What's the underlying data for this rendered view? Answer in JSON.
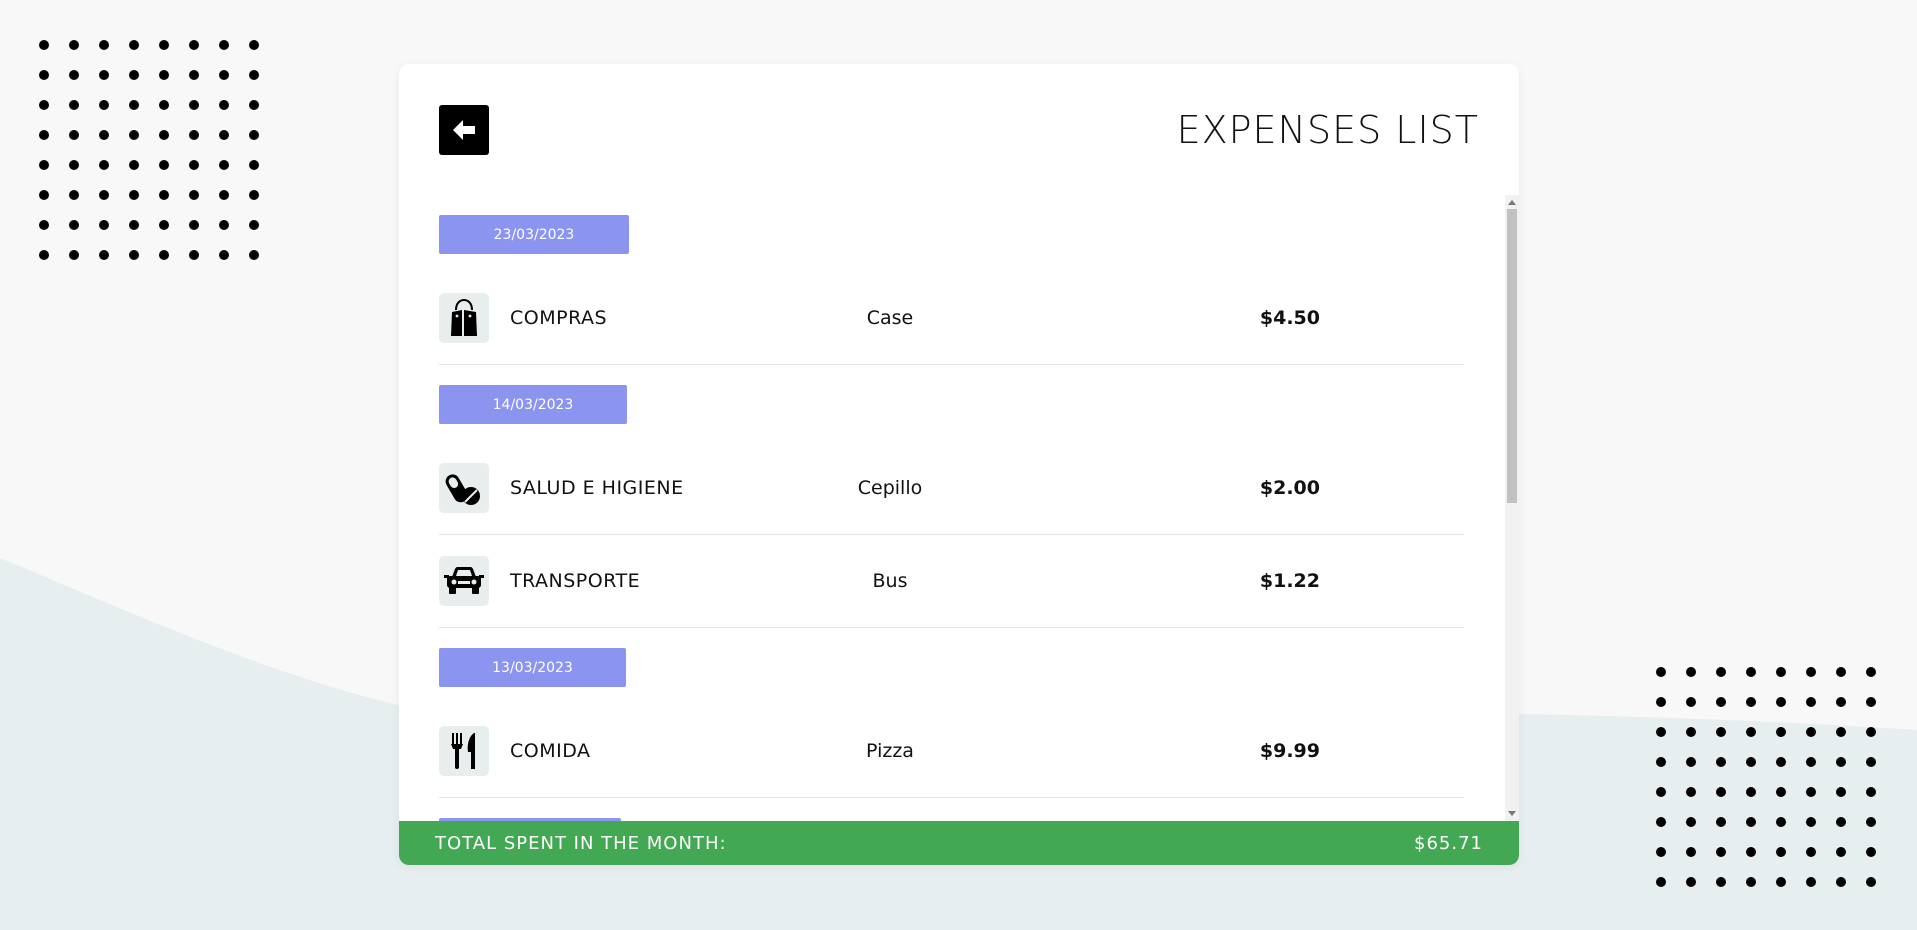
{
  "header": {
    "title": "EXPENSES LIST",
    "back_icon": "arrow-left-icon"
  },
  "groups": [
    {
      "date": "23/03/2023",
      "items": [
        {
          "category": "COMPRAS",
          "icon": "shopping-bag-icon",
          "description": "Case",
          "amount": "$4.50"
        }
      ]
    },
    {
      "date": "14/03/2023",
      "items": [
        {
          "category": "SALUD E HIGIENE",
          "icon": "pills-icon",
          "description": "Cepillo",
          "amount": "$2.00"
        },
        {
          "category": "TRANSPORTE",
          "icon": "car-icon",
          "description": "Bus",
          "amount": "$1.22"
        }
      ]
    },
    {
      "date": "13/03/2023",
      "items": [
        {
          "category": "COMIDA",
          "icon": "utensils-icon",
          "description": "Pizza",
          "amount": "$9.99"
        }
      ]
    }
  ],
  "footer": {
    "label": "TOTAL SPENT IN THE MONTH:",
    "total": "$65.71"
  },
  "colors": {
    "date_badge": "#8b94ee",
    "total_bar": "#43a853",
    "icon_bg": "#e8eeee"
  }
}
